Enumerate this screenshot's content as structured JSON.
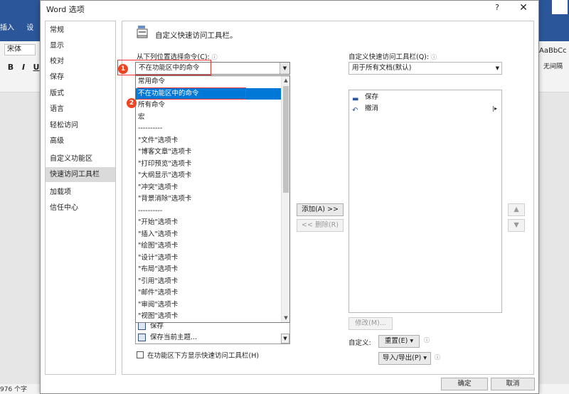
{
  "background": {
    "tabs": [
      "插入",
      "设"
    ],
    "font_name": "宋体",
    "format_buttons": [
      "B",
      "I",
      "U"
    ],
    "style_sample": "AaBbCc",
    "style_name": "无间隔",
    "status_text": "976 个字"
  },
  "dialog": {
    "title": "Word 选项",
    "help": "?",
    "close": "✕"
  },
  "nav": {
    "items": [
      "常规",
      "显示",
      "校对",
      "保存",
      "版式",
      "语言",
      "轻松访问",
      "高级",
      "自定义功能区",
      "快速访问工具栏",
      "加载项",
      "信任中心"
    ],
    "selected": "快速访问工具栏"
  },
  "section_title": "自定义快速访问工具栏。",
  "choose": {
    "label": "从下列位置选择命令(C):",
    "value": "不在功能区中的命令",
    "options": [
      "常用命令",
      "不在功能区中的命令",
      "所有命令",
      "宏",
      "----------",
      "\"文件\"选项卡",
      "\"博客文章\"选项卡",
      "\"打印预览\"选项卡",
      "\"大纲显示\"选项卡",
      "\"冲突\"选项卡",
      "\"背景消除\"选项卡",
      "----------",
      "\"开始\"选项卡",
      "\"插入\"选项卡",
      "\"绘图\"选项卡",
      "\"设计\"选项卡",
      "\"布局\"选项卡",
      "\"引用\"选项卡",
      "\"邮件\"选项卡",
      "\"审阅\"选项卡",
      "\"视图\"选项卡"
    ],
    "highlighted": "不在功能区中的命令"
  },
  "command_list": {
    "items": [
      "保存",
      "保存当前主题..."
    ]
  },
  "show_below_label": "在功能区下方显示快速访问工具栏(H)",
  "buttons": {
    "add": "添加(A) >>",
    "remove": "<< 删除(R)",
    "up": "▲",
    "down": "▼",
    "modify": "修改(M)...",
    "reset": "重置(E) ▾",
    "import_export": "导入/导出(P) ▾",
    "ok": "确定",
    "cancel": "取消"
  },
  "customize": {
    "label": "自定义快速访问工具栏(Q):",
    "value": "用于所有文档(默认)",
    "items": [
      "保存",
      "撤消"
    ]
  },
  "custom_row_label": "自定义:",
  "callouts": [
    "1",
    "2"
  ]
}
